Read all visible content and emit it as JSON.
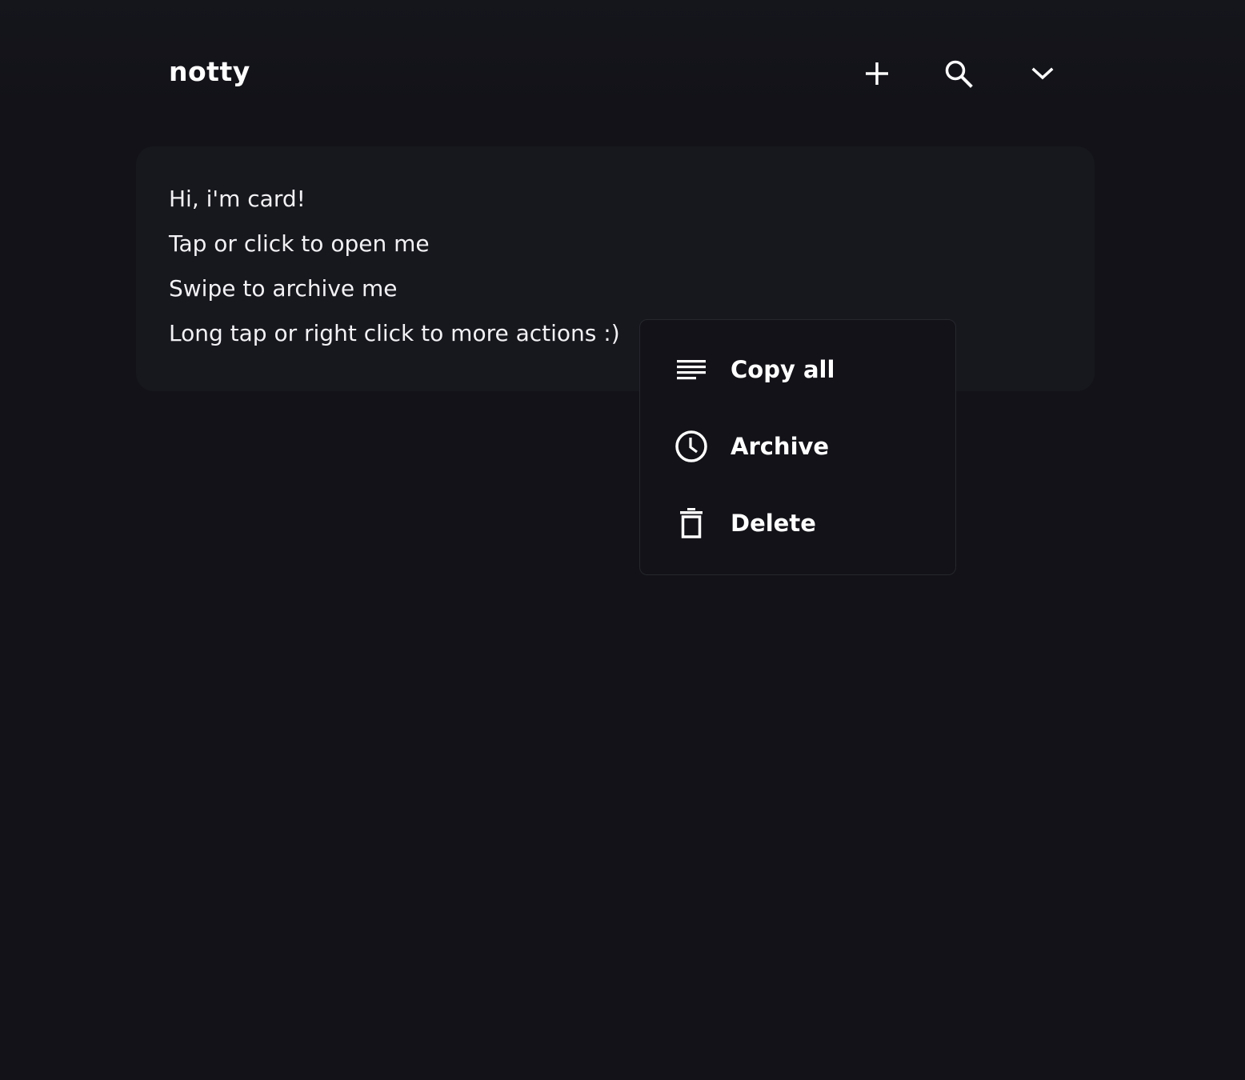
{
  "header": {
    "title": "notty",
    "actions": [
      {
        "icon": "plus-icon"
      },
      {
        "icon": "search-icon"
      },
      {
        "icon": "chevron-down-icon"
      }
    ]
  },
  "card": {
    "lines": [
      "Hi, i'm card!",
      "Tap or click to open me",
      "Swipe to archive me",
      "Long tap or right click to more actions :)"
    ]
  },
  "context_menu": {
    "items": [
      {
        "label": "Copy all",
        "icon": "text-lines-icon"
      },
      {
        "label": "Archive",
        "icon": "clock-icon"
      },
      {
        "label": "Delete",
        "icon": "trash-icon"
      }
    ]
  },
  "colors": {
    "background": "#121218",
    "card": "#17171e",
    "menu_border": "#26262e",
    "text": "#ffffff"
  }
}
